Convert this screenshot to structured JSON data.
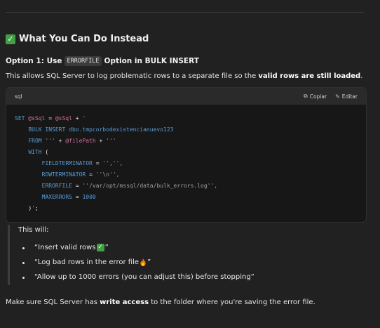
{
  "section": {
    "heading": "What You Can Do Instead",
    "heading_icon": "check-mark-emoji"
  },
  "option1": {
    "prefix": "Option 1: Use",
    "code": "ERRORFILE",
    "suffix": "Option in BULK INSERT"
  },
  "intro": {
    "text_before": "This allows SQL Server to log problematic rows to a separate file so the ",
    "bold": "valid rows are still loaded",
    "text_after": "."
  },
  "codeblock": {
    "language": "sql",
    "copy_label": "Copiar",
    "edit_label": "Editar",
    "copy_icon": "copy-icon",
    "edit_icon": "edit-icon",
    "lines": [
      "SET @sSql = @sSql + '",
      "    BULK INSERT dbo.tmpcorbodexistencianuevo123",
      "    FROM ''' + @filePath + '''",
      "    WITH (",
      "        FIELDTERMINATOR = '','',",
      "        ROWTERMINATOR = ''\\n'',",
      "        ERRORFILE = ''/var/opt/mssql/data/bulk_errors.log'',",
      "        MAXERRORS = 1000",
      "    )';"
    ]
  },
  "quote": {
    "title": "This will:",
    "items": [
      "“Insert valid rows ",
      "“Log bad rows in the error file ",
      "“Allow up to 1000 errors (you can adjust this) before stopping”"
    ],
    "item_suffix": "”",
    "item_icons": [
      "check-mark-emoji",
      "fire-emoji",
      ""
    ]
  },
  "footer": {
    "text_before": "Make sure SQL Server has ",
    "bold": "write access",
    "text_after": " to the folder where you're saving the error file."
  },
  "colors": {
    "background": "#212121",
    "code_background": "#171717",
    "keyword": "#569cd6",
    "variable": "#ce6d9e",
    "string": "#a0a0a0",
    "emoji_green": "#43a047"
  }
}
